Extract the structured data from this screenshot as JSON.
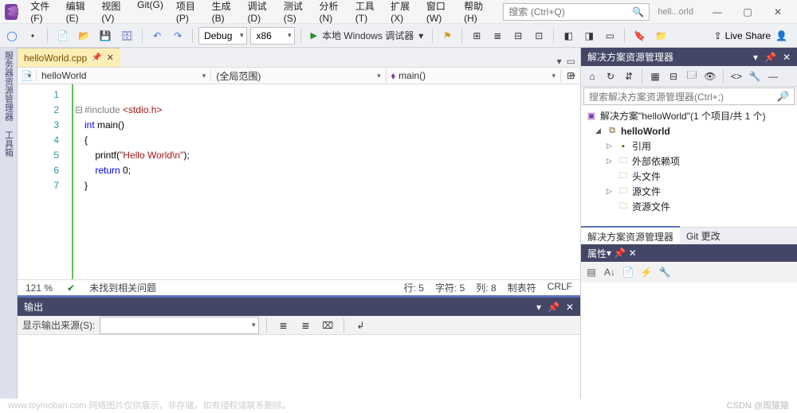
{
  "menu": [
    "文件(F)",
    "编辑(E)",
    "视图(V)",
    "Git(G)",
    "项目(P)",
    "生成(B)",
    "调试(D)",
    "测试(S)",
    "分析(N)",
    "工具(T)",
    "扩展(X)",
    "窗口(W)",
    "帮助(H)"
  ],
  "search_placeholder": "搜索 (Ctrl+Q)",
  "window_caption": "hell...orld",
  "toolbar": {
    "config": "Debug",
    "platform": "x86",
    "start_label": "本地 Windows 调试器",
    "live_share": "Live Share"
  },
  "tab": {
    "name": "helloWorld.cpp"
  },
  "nav": {
    "scope": "helloWorld",
    "region": "(全局范围)",
    "func": "main()"
  },
  "code": {
    "lines": [
      1,
      2,
      3,
      4,
      5,
      6,
      7
    ],
    "l1_a": "#include ",
    "l1_b": "<stdio.h>",
    "l2_a": "int ",
    "l2_b": "main()",
    "l3": "{",
    "l4_a": "    printf(",
    "l4_b": "\"Hello World",
    "l4_c": "\\n",
    "l4_d": "\"",
    "l4_e": ");",
    "l5_a": "    ",
    "l5_b": "return ",
    "l5_c": "0;",
    "l6": "}"
  },
  "status": {
    "zoom": "121 %",
    "issues": "未找到相关问题",
    "line": "行: 5",
    "ch": "字符: 5",
    "col": "列: 8",
    "tabs": "制表符",
    "crlf": "CRLF"
  },
  "output": {
    "title": "输出",
    "src_label": "显示输出来源(S):"
  },
  "sidebar": {
    "left1": "服务器资源管理器",
    "left2": "工具箱"
  },
  "sol_explorer": {
    "title": "解决方案资源管理器",
    "search_ph": "搜索解决方案资源管理器(Ctrl+;)",
    "root": "解决方案\"helloWorld\"(1 个项目/共 1 个)",
    "project": "helloWorld",
    "nodes": [
      "引用",
      "外部依赖项",
      "头文件",
      "源文件",
      "资源文件"
    ]
  },
  "sub_tabs": [
    "解决方案资源管理器",
    "Git 更改"
  ],
  "properties": {
    "title": "属性"
  },
  "watermark_right": "CSDN @周猿猿",
  "watermark_left": "www.toymoban.com 网络图片仅供展示，非存储，如有侵权请联系删除。"
}
